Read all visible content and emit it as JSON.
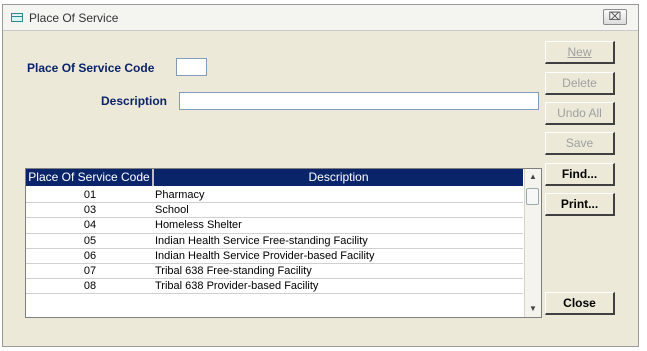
{
  "window": {
    "title": "Place Of Service",
    "close_glyph": "⌧"
  },
  "form": {
    "code_label": "Place Of Service Code",
    "code_value": "",
    "description_label": "Description",
    "description_value": ""
  },
  "buttons": {
    "new": "New",
    "delete": "Delete",
    "undo_all": "Undo All",
    "save": "Save",
    "find": "Find...",
    "print": "Print...",
    "close": "Close"
  },
  "grid": {
    "columns": [
      "Place Of Service Code",
      "Description"
    ],
    "rows": [
      {
        "code": "01",
        "description": "Pharmacy"
      },
      {
        "code": "03",
        "description": "School"
      },
      {
        "code": "04",
        "description": "Homeless Shelter"
      },
      {
        "code": "05",
        "description": "Indian Health Service Free-standing Facility"
      },
      {
        "code": "06",
        "description": "Indian Health Service Provider-based Facility"
      },
      {
        "code": "07",
        "description": "Tribal 638 Free-standing Facility"
      },
      {
        "code": "08",
        "description": "Tribal 638 Provider-based Facility"
      }
    ]
  },
  "colors": {
    "selection": "#0a246a",
    "label": "#0a246a",
    "face": "#ece9d8"
  }
}
